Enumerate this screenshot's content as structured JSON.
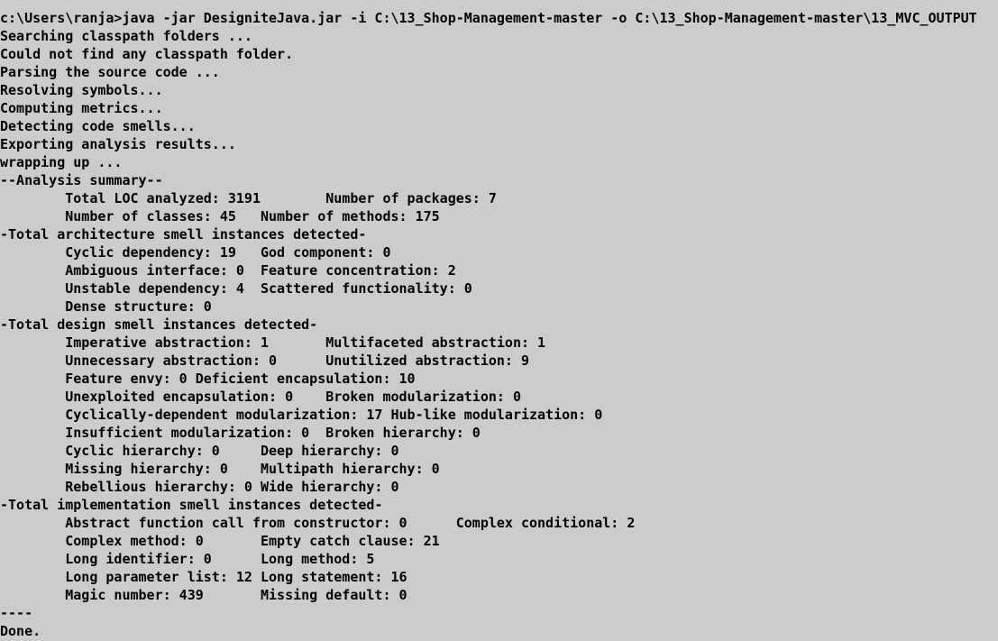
{
  "console": {
    "background": "#cccccc",
    "foreground": "#000000",
    "lines": [
      "c:\\Users\\ranja>java -jar DesigniteJava.jar -i C:\\13_Shop-Management-master -o C:\\13_Shop-Management-master\\13_MVC_OUTPUT",
      "Searching classpath folders ...",
      "Could not find any classpath folder.",
      "Parsing the source code ...",
      "Resolving symbols...",
      "Computing metrics...",
      "Detecting code smells...",
      "Exporting analysis results...",
      "wrapping up ...",
      "--Analysis summary--",
      "        Total LOC analyzed: 3191        Number of packages: 7",
      "        Number of classes: 45   Number of methods: 175",
      "-Total architecture smell instances detected-",
      "        Cyclic dependency: 19   God component: 0",
      "        Ambiguous interface: 0  Feature concentration: 2",
      "        Unstable dependency: 4  Scattered functionality: 0",
      "        Dense structure: 0",
      "-Total design smell instances detected-",
      "        Imperative abstraction: 1       Multifaceted abstraction: 1",
      "        Unnecessary abstraction: 0      Unutilized abstraction: 9",
      "        Feature envy: 0 Deficient encapsulation: 10",
      "        Unexploited encapsulation: 0    Broken modularization: 0",
      "        Cyclically-dependent modularization: 17 Hub-like modularization: 0",
      "        Insufficient modularization: 0  Broken hierarchy: 0",
      "        Cyclic hierarchy: 0     Deep hierarchy: 0",
      "        Missing hierarchy: 0    Multipath hierarchy: 0",
      "        Rebellious hierarchy: 0 Wide hierarchy: 0",
      "-Total implementation smell instances detected-",
      "        Abstract function call from constructor: 0      Complex conditional: 2",
      "        Complex method: 0       Empty catch clause: 21",
      "        Long identifier: 0      Long method: 5",
      "        Long parameter list: 12 Long statement: 16",
      "        Magic number: 439       Missing default: 0",
      "----",
      "Done."
    ]
  }
}
